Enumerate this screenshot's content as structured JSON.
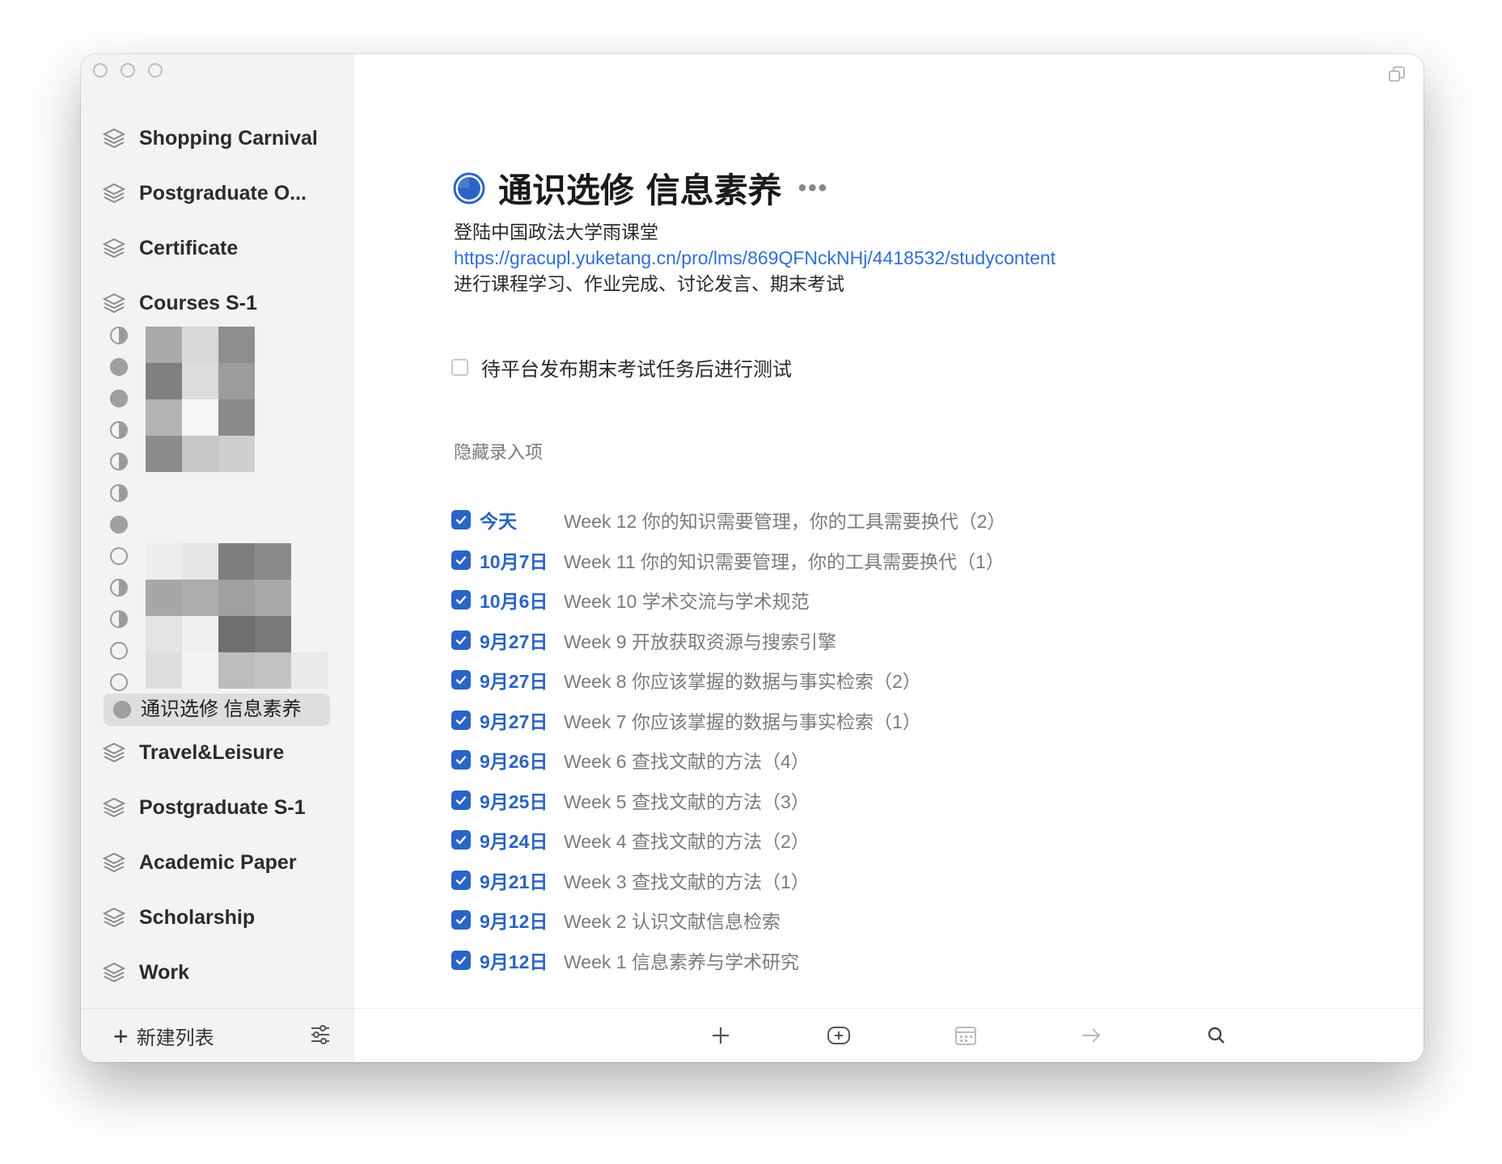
{
  "sidebar": {
    "lists_top": [
      {
        "label": "Shopping Carnival",
        "icon": "stack-icon"
      },
      {
        "label": "Postgraduate O...",
        "icon": "stack-icon"
      },
      {
        "label": "Certificate",
        "icon": "stack-icon"
      },
      {
        "label": "Courses S-1",
        "icon": "stack-icon"
      }
    ],
    "selected_item": "通识选修 信息素养",
    "lists_bottom": [
      {
        "label": "Travel&Leisure",
        "icon": "stack-icon"
      },
      {
        "label": "Postgraduate S-1",
        "icon": "stack-icon"
      },
      {
        "label": "Academic Paper",
        "icon": "stack-icon"
      },
      {
        "label": "Scholarship",
        "icon": "stack-icon"
      },
      {
        "label": "Work",
        "icon": "stack-icon"
      }
    ],
    "new_list_label": "新建列表"
  },
  "main": {
    "title": "通识选修 信息素养",
    "notes": {
      "line1": "登陆中国政法大学雨课堂",
      "link": "https://gracupl.yuketang.cn/pro/lms/869QFNckNHj/4418532/studycontent",
      "line3": "进行课程学习、作业完成、讨论发言、期末考试"
    },
    "open_task": "待平台发布期末考试任务后进行测试",
    "hidden_label": "隐藏录入项",
    "completed": [
      {
        "date": "今天",
        "title": "Week 12 你的知识需要管理，你的工具需要换代（2）"
      },
      {
        "date": "10月7日",
        "title": "Week 11 你的知识需要管理，你的工具需要换代（1）"
      },
      {
        "date": "10月6日",
        "title": "Week 10 学术交流与学术规范"
      },
      {
        "date": "9月27日",
        "title": "Week 9 开放获取资源与搜索引擎"
      },
      {
        "date": "9月27日",
        "title": "Week 8 你应该掌握的数据与事实检索（2）"
      },
      {
        "date": "9月27日",
        "title": "Week 7 你应该掌握的数据与事实检索（1）"
      },
      {
        "date": "9月26日",
        "title": "Week 6 查找文献的方法（4）"
      },
      {
        "date": "9月25日",
        "title": "Week 5 查找文献的方法（3）"
      },
      {
        "date": "9月24日",
        "title": "Week 4 查找文献的方法（2）"
      },
      {
        "date": "9月21日",
        "title": "Week 3 查找文献的方法（1）"
      },
      {
        "date": "9月12日",
        "title": "Week 2 认识文献信息检索"
      },
      {
        "date": "9月12日",
        "title": "Week 1 信息素养与学术研究"
      }
    ]
  },
  "colors": {
    "accent": "#2a64c5",
    "link": "#2f6fd6",
    "sidebar_bg": "#f3f3f3",
    "muted_text": "#7b7b7b"
  }
}
